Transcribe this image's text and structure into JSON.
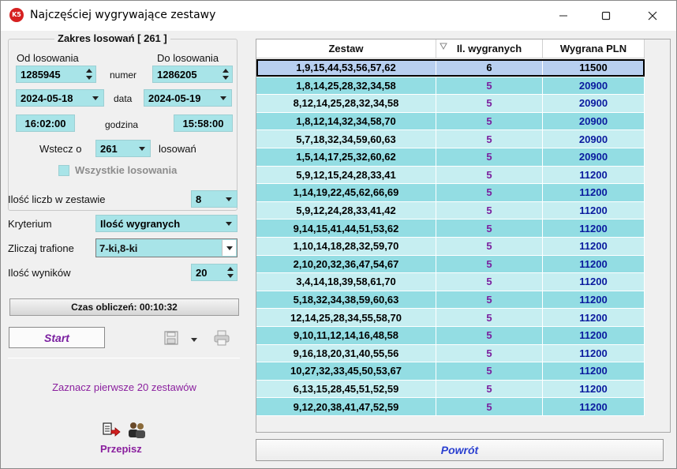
{
  "window": {
    "title": "Najczęściej wygrywające zestawy",
    "icon_text": "K5"
  },
  "range": {
    "legend": "Zakres losowań  [ 261 ]",
    "from_label": "Od losowania",
    "to_label": "Do losowania",
    "from_number": "1285945",
    "to_number": "1286205",
    "number_label": "numer",
    "from_date": "2024-05-18",
    "to_date": "2024-05-19",
    "date_label": "data",
    "from_time": "16:02:00",
    "to_time": "15:58:00",
    "time_label": "godzina",
    "back_label": "Wstecz o",
    "back_value": "261",
    "back_suffix": "losowań",
    "all_label": "Wszystkie losowania"
  },
  "options": {
    "count_label": "Ilość liczb w zestawie",
    "count_value": "8",
    "criterion_label": "Kryterium",
    "criterion_value": "Ilość wygranych",
    "hits_label": "Zliczaj trafione",
    "hits_value": "7-ki,8-ki",
    "results_label": "Ilość wyników",
    "results_value": "20"
  },
  "compute": {
    "time_text": "Czas obliczeń: 00:10:32",
    "start_label": "Start"
  },
  "actions": {
    "mark_text": "Zaznacz pierwsze 20 zestawów",
    "rewrite_label": "Przepisz",
    "back_button": "Powrót"
  },
  "table": {
    "headers": [
      "Zestaw",
      "Il. wygranych",
      "Wygrana PLN"
    ],
    "rows": [
      [
        "1,9,15,44,53,56,57,62",
        "6",
        "11500"
      ],
      [
        "1,8,14,25,28,32,34,58",
        "5",
        "20900"
      ],
      [
        "8,12,14,25,28,32,34,58",
        "5",
        "20900"
      ],
      [
        "1,8,12,14,32,34,58,70",
        "5",
        "20900"
      ],
      [
        "5,7,18,32,34,59,60,63",
        "5",
        "20900"
      ],
      [
        "1,5,14,17,25,32,60,62",
        "5",
        "20900"
      ],
      [
        "5,9,12,15,24,28,33,41",
        "5",
        "11200"
      ],
      [
        "1,14,19,22,45,62,66,69",
        "5",
        "11200"
      ],
      [
        "5,9,12,24,28,33,41,42",
        "5",
        "11200"
      ],
      [
        "9,14,15,41,44,51,53,62",
        "5",
        "11200"
      ],
      [
        "1,10,14,18,28,32,59,70",
        "5",
        "11200"
      ],
      [
        "2,10,20,32,36,47,54,67",
        "5",
        "11200"
      ],
      [
        "3,4,14,18,39,58,61,70",
        "5",
        "11200"
      ],
      [
        "5,18,32,34,38,59,60,63",
        "5",
        "11200"
      ],
      [
        "12,14,25,28,34,55,58,70",
        "5",
        "11200"
      ],
      [
        "9,10,11,12,14,16,48,58",
        "5",
        "11200"
      ],
      [
        "9,16,18,20,31,40,55,56",
        "5",
        "11200"
      ],
      [
        "10,27,32,33,45,50,53,67",
        "5",
        "11200"
      ],
      [
        "6,13,15,28,45,51,52,59",
        "5",
        "11200"
      ],
      [
        "9,12,20,38,41,47,52,59",
        "5",
        "11200"
      ]
    ]
  },
  "icons": [
    "minimize-icon",
    "maximize-icon",
    "close-icon",
    "save-icon",
    "dropdown-arrow-icon",
    "print-icon",
    "copy-icon",
    "users-icon",
    "sort-icon"
  ]
}
